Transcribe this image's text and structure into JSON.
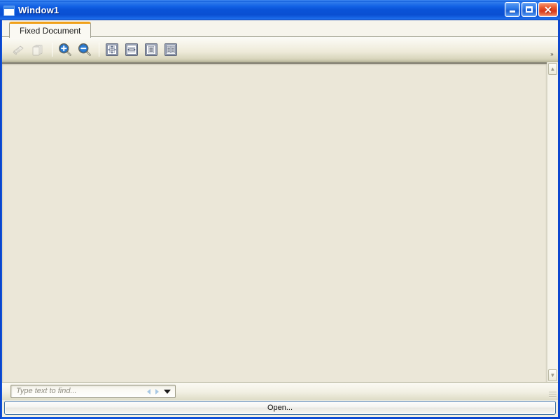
{
  "window": {
    "title": "Window1",
    "icon": "window-icon",
    "caption_buttons": [
      {
        "name": "minimize-button",
        "label": "Minimize",
        "glyph": "minimize"
      },
      {
        "name": "maximize-button",
        "label": "Maximize",
        "glyph": "maximize"
      },
      {
        "name": "close-button",
        "label": "Close",
        "glyph": "✕"
      }
    ]
  },
  "tabs": [
    {
      "label": "Fixed Document",
      "selected": true
    }
  ],
  "toolbar": {
    "overflow_glyph": "»",
    "buttons": [
      {
        "name": "print-button",
        "icon": "printer-icon",
        "label": "Print",
        "enabled": false
      },
      {
        "name": "copy-button",
        "icon": "copy-pages-icon",
        "label": "Copy",
        "enabled": false
      },
      {
        "name": "zoom-in-button",
        "icon": "zoom-in-icon",
        "label": "Zoom In",
        "enabled": true
      },
      {
        "name": "zoom-out-button",
        "icon": "zoom-out-icon",
        "label": "Zoom Out",
        "enabled": true
      },
      {
        "name": "actual-size-button",
        "icon": "fit-page-icon",
        "label": "Actual Size",
        "enabled": true
      },
      {
        "name": "fit-to-width-button",
        "icon": "fit-width-icon",
        "label": "Fit to Width",
        "enabled": true
      },
      {
        "name": "one-page-view-button",
        "icon": "single-page-icon",
        "label": "Whole Page",
        "enabled": true
      },
      {
        "name": "two-page-view-button",
        "icon": "two-page-icon",
        "label": "Two Pages",
        "enabled": true
      }
    ]
  },
  "document": {
    "background_color": "#ebe7d8",
    "content": ""
  },
  "scrollbar": {
    "up_glyph": "▲",
    "down_glyph": "▼"
  },
  "find": {
    "placeholder": "Type text to find...",
    "value": "",
    "previous_label": "Previous",
    "next_label": "Next",
    "options_label": "Find Options"
  },
  "footer": {
    "open_label": "Open..."
  },
  "colors": {
    "titlebar_blue": "#0d46cf",
    "tab_accent_orange": "#f0a018",
    "document_cream": "#ebe7d8",
    "toolbar_khaki": "#bdbb9e",
    "close_red": "#d8381a"
  }
}
